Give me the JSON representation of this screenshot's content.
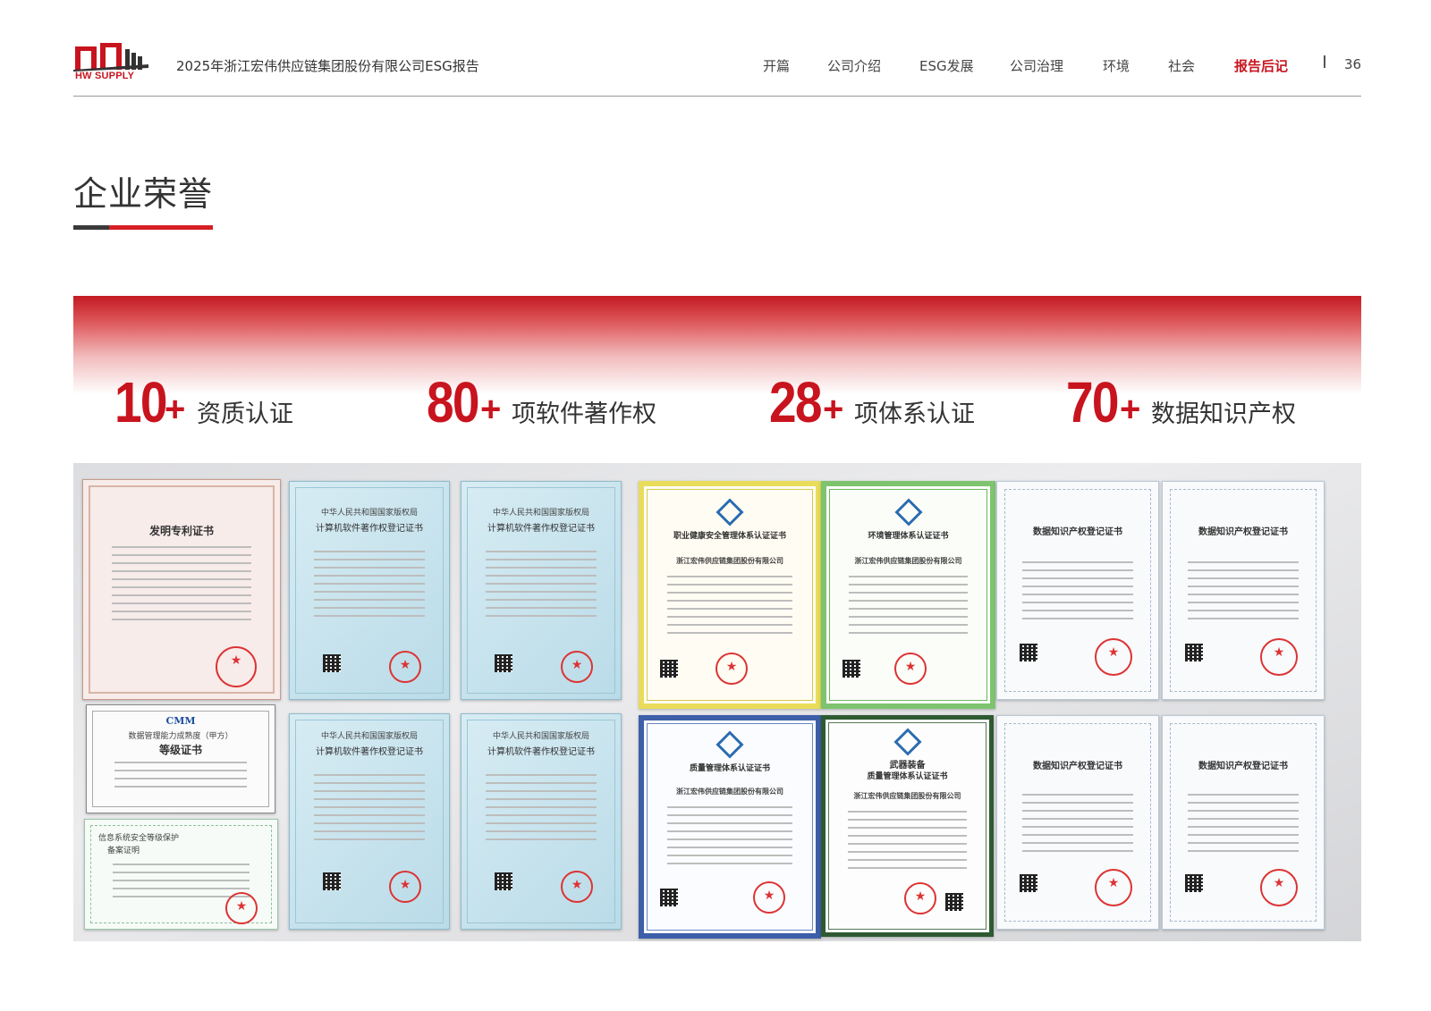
{
  "header": {
    "logo_text": "HW SUPPLY",
    "doc_title": "2025年浙江宏伟供应链集团股份有限公司ESG报告",
    "nav": [
      {
        "label": "开篇",
        "active": false
      },
      {
        "label": "公司介绍",
        "active": false
      },
      {
        "label": "ESG发展",
        "active": false
      },
      {
        "label": "公司治理",
        "active": false
      },
      {
        "label": "环境",
        "active": false
      },
      {
        "label": "社会",
        "active": false
      },
      {
        "label": "报告后记",
        "active": true
      }
    ],
    "page_number": "36"
  },
  "section_title": "企业荣誉",
  "stats": [
    {
      "number": "10",
      "plus": "+",
      "label": "资质认证"
    },
    {
      "number": "80",
      "plus": "+",
      "label": "项软件著作权"
    },
    {
      "number": "28",
      "plus": "+",
      "label": "项体系认证"
    },
    {
      "number": "70",
      "plus": "+",
      "label": "数据知识产权"
    }
  ],
  "certificates": {
    "patent": "发明专利证书",
    "cmm": "CMM",
    "cmm_sub": "数据管理能力成熟度（甲方）",
    "cmm_grade": "等级证书",
    "security": "信息系统安全等级保护",
    "security_sub": "备案证明",
    "software_authority": "中华人民共和国国家版权局",
    "software_title": "计算机软件著作权登记证书",
    "ohs": "职业健康安全管理体系认证证书",
    "env": "环境管理体系认证证书",
    "quality": "质量管理体系认证证书",
    "weapon": "武器装备",
    "weapon_sub": "质量管理体系认证证书",
    "data_ip": "数据知识产权登记证书",
    "company": "浙江宏伟供应链集团股份有限公司"
  },
  "colors": {
    "brand_red": "#c8141e",
    "text_dark": "#333333"
  }
}
